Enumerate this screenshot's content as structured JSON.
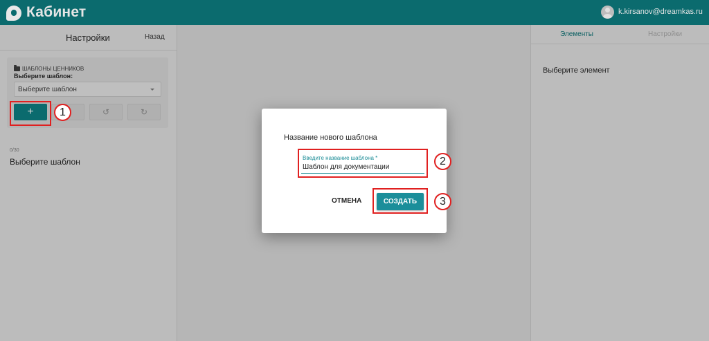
{
  "header": {
    "brand": "Кабинет",
    "user_email": "k.kirsanov@dreamkas.ru",
    "bg_color": "#0b6b6e"
  },
  "left_panel": {
    "title": "Настройки",
    "back_label": "Назад",
    "section_title": "ШАБЛОНЫ ЦЕННИКОВ",
    "select_label": "Выберите шаблон:",
    "select_value": "Выберите шаблон",
    "add_label": "+",
    "counter": "0/30",
    "empty_text": "Выберите шаблон"
  },
  "right_panel": {
    "tabs": [
      {
        "label": "Элементы",
        "active": true
      },
      {
        "label": "Настройки",
        "active": false
      }
    ],
    "empty_text": "Выберите элемент"
  },
  "dialog": {
    "title": "Название нового шаблона",
    "field_label": "Введите название шаблона *",
    "field_value": "Шаблон для документации",
    "cancel_label": "ОТМЕНА",
    "create_label": "СОЗДАТЬ",
    "accent_color": "#1b8e9a"
  },
  "annotations": {
    "step1": "1",
    "step2": "2",
    "step3": "3",
    "color": "#e02020"
  }
}
